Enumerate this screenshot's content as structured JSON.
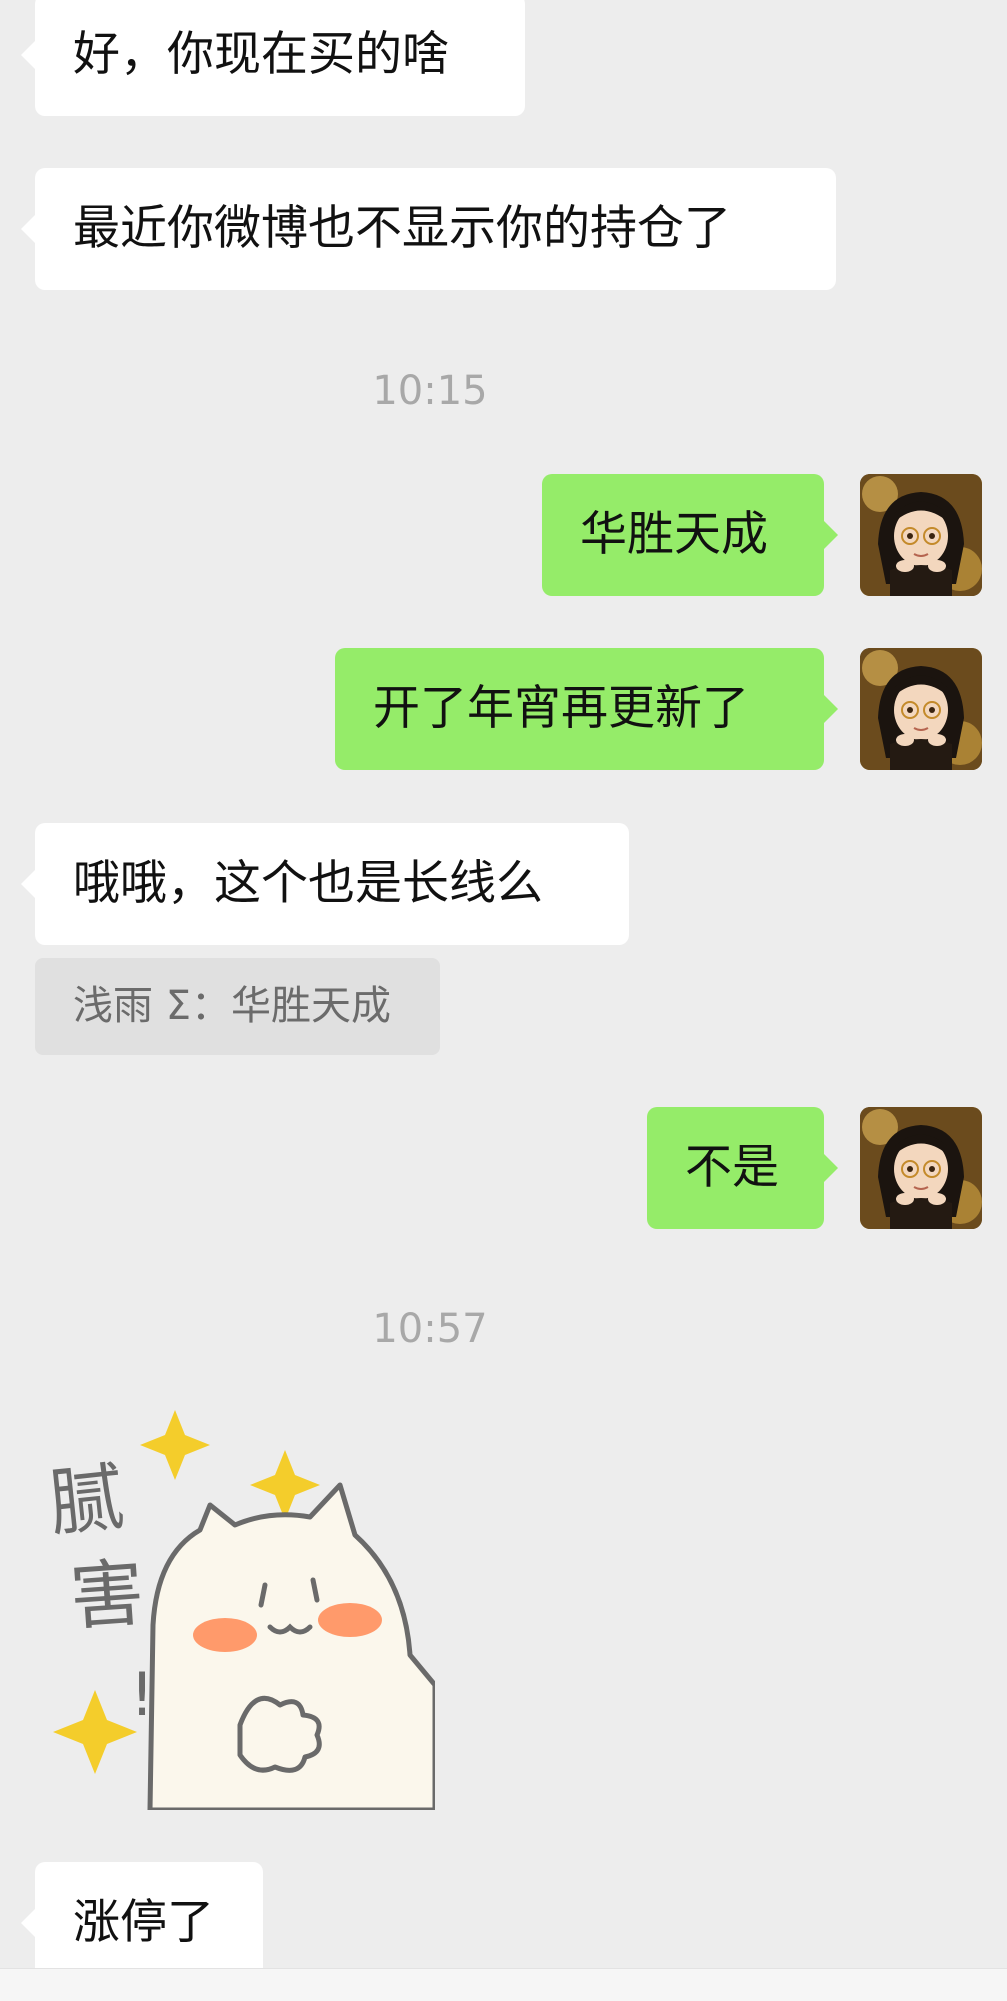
{
  "messages": {
    "m1": "好，你现在买的啥",
    "m2": "最近你微博也不显示你的持仓了",
    "t1": "10:15",
    "m3": "华胜天成",
    "m4": "开了年宵再更新了",
    "m5": "哦哦，这个也是长线么",
    "quote": "浅雨 Σ：华胜天成",
    "m6": "不是",
    "t2": "10:57",
    "m7": "涨停了"
  },
  "sticker": {
    "text_line1": "腻",
    "text_line2": "害",
    "text_mark": "!"
  },
  "colors": {
    "background": "#ededed",
    "incoming_bubble": "#ffffff",
    "outgoing_bubble": "#95ec69",
    "timestamp": "#a8a8a8",
    "quote_bg": "#e0e0e0"
  },
  "icons": {
    "avatar": "avatar-girl-icon"
  }
}
